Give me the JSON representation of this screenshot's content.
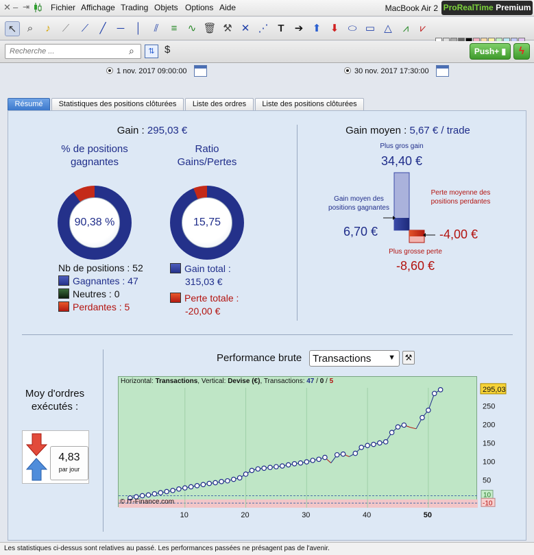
{
  "menubar": {
    "items": [
      "Fichier",
      "Affichage",
      "Trading",
      "Objets",
      "Options",
      "Aide"
    ],
    "device": "MacBook Air 2",
    "brand_green": "ProRealTime",
    "brand_white": "Premium"
  },
  "search": {
    "placeholder": "Recherche ..."
  },
  "push_label": "Push+",
  "dates": {
    "start": "1 nov. 2017 09:00:00",
    "end": "30 nov. 2017 17:30:00"
  },
  "tabs": [
    "Résumé",
    "Statistiques des positions clôturées",
    "Liste des ordres",
    "Liste des positions clôturées"
  ],
  "summary": {
    "gain_label": "Gain : ",
    "gain_value": "295,03 €",
    "pct_win_title": "% de positions gagnantes",
    "pct_win_value": "90,38 %",
    "ratio_title": "Ratio Gains/Pertes",
    "ratio_value": "15,75",
    "nb_positions": "Nb de positions : 52",
    "winning": "Gagnantes : 47",
    "neutral": "Neutres : 0",
    "losing": "Perdantes : 5",
    "gain_total_label": "Gain total :",
    "gain_total_value": "315,03 €",
    "loss_total_label": "Perte totale :",
    "loss_total_value": "-20,00 €"
  },
  "avg": {
    "title_label": "Gain moyen : ",
    "title_value": "5,67 € / trade",
    "biggest_gain_label": "Plus gros gain",
    "biggest_gain_value": "34,40 €",
    "avg_gain_label": "Gain moyen des positions gagnantes",
    "avg_gain_value": "6,70 €",
    "avg_loss_label": "Perte moyenne des positions perdantes",
    "avg_loss_value": "-4,00 €",
    "biggest_loss_label": "Plus grosse perte",
    "biggest_loss_value": "-8,60 €"
  },
  "orders": {
    "title": "Moy d'ordres exécutés :",
    "value": "4,83",
    "unit": "par jour"
  },
  "performance": {
    "title": "Performance brute",
    "select_value": "Transactions",
    "info_horizontal_label": "Horizontal: ",
    "info_horizontal_value": "Transactions",
    "info_vertical_label": ", Vertical: ",
    "info_vertical_value": "Devise (€)",
    "info_transactions_label": ", Transactions: ",
    "info_win": "47",
    "info_sep1": " / ",
    "info_neutral": "0",
    "info_sep2": " / ",
    "info_loss": "5",
    "copyright": "© IT-Finance.com",
    "last_value_label": "295,03",
    "band_top_label": "10",
    "band_bottom_label": "-10"
  },
  "chart_data": {
    "type": "line",
    "xlabel": "",
    "ylabel": "",
    "xlim": [
      0,
      57
    ],
    "ylim": [
      -15,
      315
    ],
    "x_ticks": [
      10,
      20,
      30,
      40,
      50
    ],
    "y_ticks": [
      50,
      100,
      150,
      200,
      250
    ],
    "highlight_x": 50,
    "band": [
      -10,
      10
    ],
    "x": [
      1,
      2,
      3,
      4,
      5,
      6,
      7,
      8,
      9,
      10,
      11,
      12,
      13,
      14,
      15,
      16,
      17,
      18,
      19,
      20,
      21,
      22,
      23,
      24,
      25,
      26,
      27,
      28,
      29,
      30,
      31,
      32,
      33,
      34,
      35,
      36,
      37,
      38,
      39,
      40,
      41,
      42,
      43,
      44,
      45,
      46,
      47,
      48,
      49,
      50,
      51,
      52
    ],
    "y": [
      4,
      7,
      10,
      12,
      15,
      18,
      21,
      24,
      28,
      31,
      34,
      37,
      40,
      43,
      45,
      48,
      50,
      54,
      58,
      68,
      78,
      82,
      84,
      86,
      88,
      90,
      93,
      96,
      98,
      101,
      105,
      108,
      113,
      98,
      120,
      122,
      115,
      124,
      140,
      145,
      148,
      152,
      155,
      180,
      195,
      200,
      194,
      190,
      220,
      240,
      285,
      295.03
    ],
    "win_color": "#1f2d8a",
    "loss_color": "#b3130f",
    "line_color": "#1f2d8a"
  },
  "footer": "Les statistiques ci-dessus sont relatives au passé. Les performances passées ne présagent pas de l'avenir."
}
